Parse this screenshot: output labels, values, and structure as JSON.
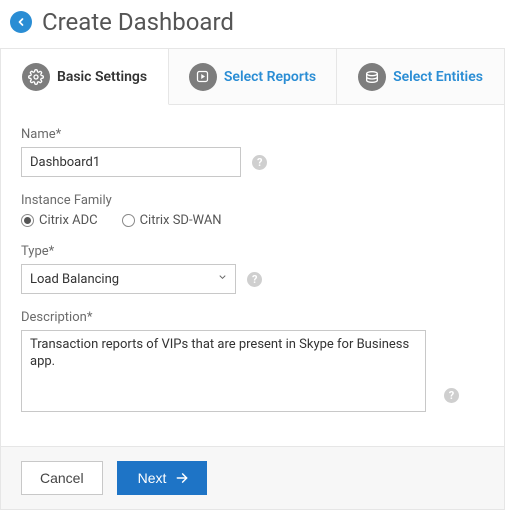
{
  "header": {
    "title": "Create Dashboard"
  },
  "tabs": {
    "basic": "Basic Settings",
    "reports": "Select Reports",
    "entities": "Select Entities"
  },
  "form": {
    "name_label": "Name*",
    "name_value": "Dashboard1",
    "family_label": "Instance Family",
    "family_options": {
      "adc": "Citrix ADC",
      "sdwan": "Citrix SD-WAN"
    },
    "family_selected": "adc",
    "type_label": "Type*",
    "type_value": "Load Balancing",
    "desc_label": "Description*",
    "desc_value": "Transaction reports of VIPs that are present in Skype for Business app."
  },
  "footer": {
    "cancel": "Cancel",
    "next": "Next"
  },
  "help": "?"
}
